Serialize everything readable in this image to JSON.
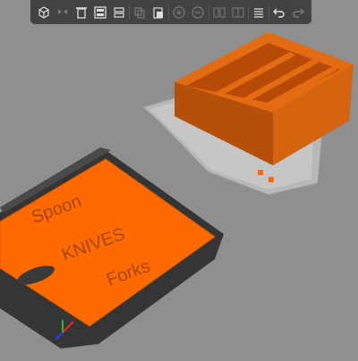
{
  "app": "3D Slicer Plater",
  "toolbar": {
    "buttons": [
      {
        "name": "add-object-icon",
        "enabled": true
      },
      {
        "name": "delete-icon",
        "enabled": false
      },
      {
        "name": "delete-all-icon",
        "enabled": true
      },
      {
        "name": "arrange-icon",
        "enabled": true
      },
      {
        "name": "arrange-selection-icon",
        "enabled": true
      },
      {
        "name": "copy-icon",
        "enabled": false
      },
      {
        "name": "paste-icon",
        "enabled": true
      },
      {
        "name": "add-instance-icon",
        "enabled": false
      },
      {
        "name": "remove-instance-icon",
        "enabled": false
      },
      {
        "name": "split-objects-icon",
        "enabled": false
      },
      {
        "name": "split-parts-icon",
        "enabled": false
      },
      {
        "name": "layers-icon",
        "enabled": true
      },
      {
        "name": "undo-icon",
        "enabled": true
      },
      {
        "name": "redo-icon",
        "enabled": false
      }
    ]
  },
  "scene": {
    "plate_text": [
      "Spoon",
      "KNIVES",
      "Forks"
    ],
    "colors": {
      "background": "#8f8f8f",
      "bed": "#3a3a3a",
      "model": "#ff6a00",
      "model_dark": "#b84a08",
      "ghost_bed": "#bdbdbd"
    }
  }
}
